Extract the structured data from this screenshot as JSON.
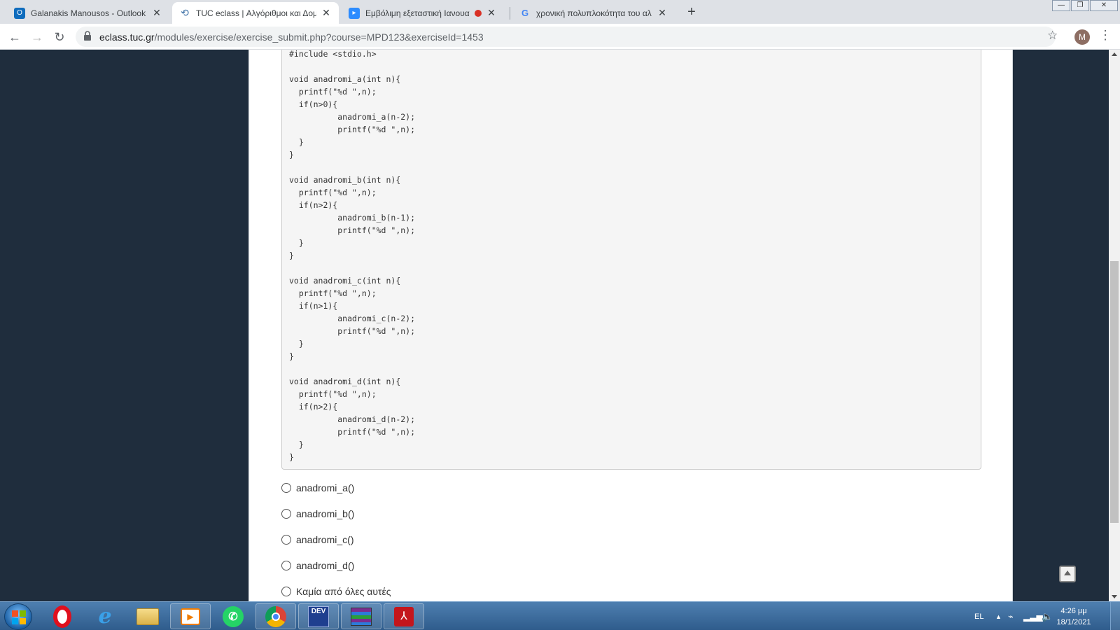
{
  "browser": {
    "tabs": [
      {
        "title": "Galanakis Manousos - Outlook W",
        "icon": "outlook-icon",
        "active": false
      },
      {
        "title": "TUC eclass | Αλγόριθμοι και Δομ",
        "icon": "eclass-icon",
        "active": true
      },
      {
        "title": "Εμβόλιμη εξεταστική Ιανουα",
        "icon": "zoom-icon",
        "active": false
      },
      {
        "title": "χρονική πολυπλοκότητα του αλ",
        "icon": "google-icon",
        "active": false
      }
    ],
    "new_tab": "+",
    "window_controls": {
      "minimize": "—",
      "restore": "❐",
      "close": "✕"
    },
    "url_domain": "eclass.tuc.gr",
    "url_path": "/modules/exercise/exercise_submit.php?course=MPD123&exerciseId=1453",
    "profile_initial": "M"
  },
  "question": {
    "code": "#include <stdio.h>\n\nvoid anadromi_a(int n){\n  printf(\"%d \",n);\n  if(n>0){\n          anadromi_a(n-2);\n          printf(\"%d \",n);\n  }\n}\n\nvoid anadromi_b(int n){\n  printf(\"%d \",n);\n  if(n>2){\n          anadromi_b(n-1);\n          printf(\"%d \",n);\n  }\n}\n\nvoid anadromi_c(int n){\n  printf(\"%d \",n);\n  if(n>1){\n          anadromi_c(n-2);\n          printf(\"%d \",n);\n  }\n}\n\nvoid anadromi_d(int n){\n  printf(\"%d \",n);\n  if(n>2){\n          anadromi_d(n-2);\n          printf(\"%d \",n);\n  }\n}",
    "options": [
      {
        "label": "anadromi_a()"
      },
      {
        "label": "anadromi_b()"
      },
      {
        "label": "anadromi_c()"
      },
      {
        "label": "anadromi_d()"
      },
      {
        "label": "Καμία από όλες αυτές"
      }
    ]
  },
  "taskbar": {
    "apps": [
      {
        "name": "opera",
        "icon": "opera-icon"
      },
      {
        "name": "internet-explorer",
        "icon": "ie-icon"
      },
      {
        "name": "file-explorer",
        "icon": "folder-icon"
      },
      {
        "name": "media-player",
        "icon": "media-player-icon"
      },
      {
        "name": "whatsapp",
        "icon": "whatsapp-icon"
      },
      {
        "name": "chrome",
        "icon": "chrome-icon"
      },
      {
        "name": "dev-cpp",
        "icon": "dev-cpp-icon",
        "text": "DEV"
      },
      {
        "name": "winrar",
        "icon": "winrar-icon"
      },
      {
        "name": "acrobat",
        "icon": "acrobat-icon"
      }
    ],
    "language": "EL",
    "time": "4:26 μμ",
    "date": "18/1/2021"
  }
}
